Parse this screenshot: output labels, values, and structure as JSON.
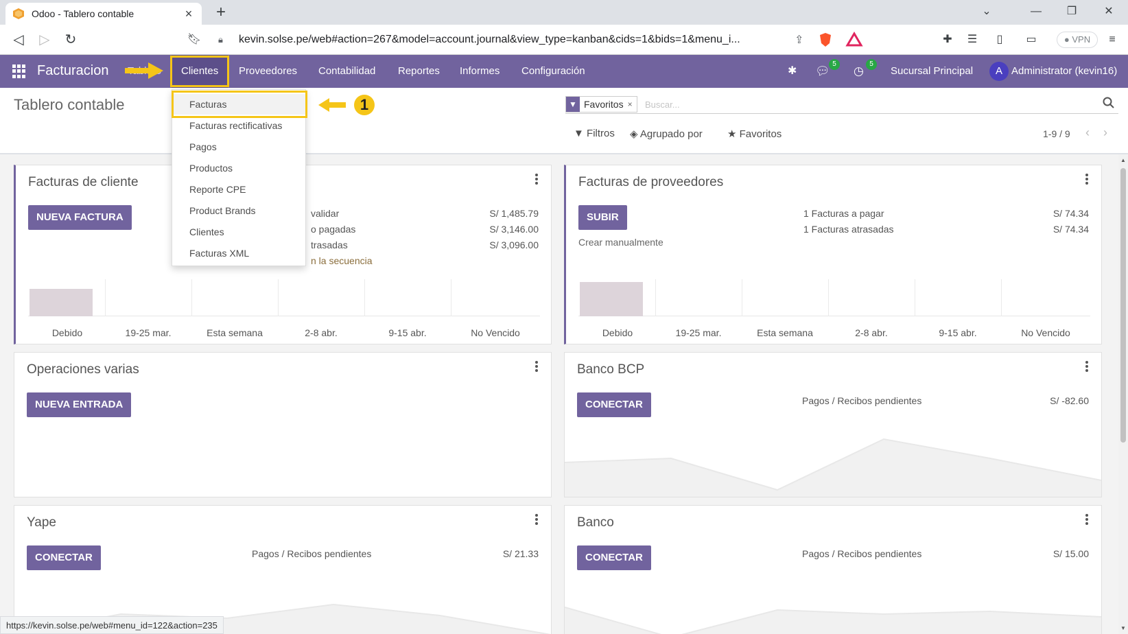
{
  "browser": {
    "tab_title": "Odoo - Tablero contable",
    "url": "kevin.solse.pe/web#action=267&model=account.journal&view_type=kanban&cids=1&bids=1&menu_i...",
    "vpn_label": "VPN",
    "status_url": "https://kevin.solse.pe/web#menu_id=122&action=235"
  },
  "navbar": {
    "brand": "Facturacion",
    "hidden_item": "Tablero",
    "menu": [
      {
        "label": "Clientes"
      },
      {
        "label": "Proveedores"
      },
      {
        "label": "Contabilidad"
      },
      {
        "label": "Reportes"
      },
      {
        "label": "Informes"
      },
      {
        "label": "Configuración"
      }
    ],
    "messages_badge": "5",
    "activities_badge": "5",
    "branch": "Sucursal Principal",
    "avatar_letter": "A",
    "user": "Administrator (kevin16)"
  },
  "control_panel": {
    "title": "Tablero contable",
    "facet": "Favoritos",
    "facet_remove": "×",
    "search_placeholder": "Buscar...",
    "filters": "Filtros",
    "group_by": "Agrupado por",
    "favorites": "Favoritos",
    "pager": "1-9 / 9"
  },
  "dropdown": {
    "items": [
      "Facturas",
      "Facturas rectificativas",
      "Pagos",
      "Productos",
      "Reporte CPE",
      "Product Brands",
      "Clientes",
      "Facturas XML"
    ],
    "callout_number": "1"
  },
  "cards": {
    "customer_invoices": {
      "title": "Facturas de cliente",
      "button": "NUEVA FACTURA",
      "lines": [
        {
          "label": "validar",
          "value": "S/ 1,485.79"
        },
        {
          "label": "o pagadas",
          "value": "S/ 3,146.00"
        },
        {
          "label": "trasadas",
          "value": "S/ 3,096.00"
        }
      ],
      "sequence_link": "n la secuencia",
      "bars": [
        "Debido",
        "19-25 mar.",
        "Esta semana",
        "2-8 abr.",
        "9-15 abr.",
        "No Vencido"
      ]
    },
    "vendor_bills": {
      "title": "Facturas de proveedores",
      "button": "SUBIR",
      "manual": "Crear manualmente",
      "lines": [
        {
          "label": "1 Facturas a pagar",
          "value": "S/ 74.34"
        },
        {
          "label": "1 Facturas atrasadas",
          "value": "S/ 74.34"
        }
      ],
      "bars": [
        "Debido",
        "19-25 mar.",
        "Esta semana",
        "2-8 abr.",
        "9-15 abr.",
        "No Vencido"
      ]
    },
    "misc": {
      "title": "Operaciones varias",
      "button": "NUEVA ENTRADA"
    },
    "bcp": {
      "title": "Banco BCP",
      "button": "CONECTAR",
      "label": "Pagos / Recibos pendientes",
      "value": "S/ -82.60"
    },
    "yape": {
      "title": "Yape",
      "button": "CONECTAR",
      "label": "Pagos / Recibos pendientes",
      "value": "S/ 21.33"
    },
    "banco": {
      "title": "Banco",
      "button": "CONECTAR",
      "label": "Pagos / Recibos pendientes",
      "value": "S/ 15.00"
    }
  },
  "colors": {
    "primary": "#71639e",
    "highlight": "#f5c518"
  }
}
